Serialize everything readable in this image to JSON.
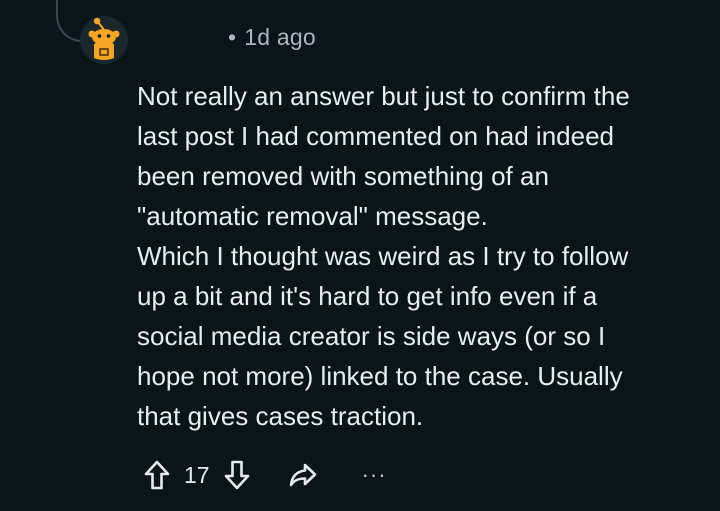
{
  "comment": {
    "author_avatar": "snoo-avatar",
    "timestamp": "1d ago",
    "body": "Not really an answer but just to confirm the\nlast post I had commented on had indeed\nbeen removed with something of an\n\"automatic removal\" message.\nWhich I thought was weird as I try to follow\nup a bit and it's hard to get info even if a\nsocial media creator is side ways (or so I\nhope not more) linked to the case. Usually\nthat gives cases traction.",
    "votes": "17",
    "more_label": "···"
  },
  "icons": {
    "upvote": "arrow-up-icon",
    "downvote": "arrow-down-icon",
    "share": "share-icon",
    "more": "more-dots-icon"
  },
  "colors": {
    "background": "#0b1416",
    "text": "#e8eef0",
    "muted": "#a8b8be",
    "avatar_orange": "#f5a623"
  }
}
